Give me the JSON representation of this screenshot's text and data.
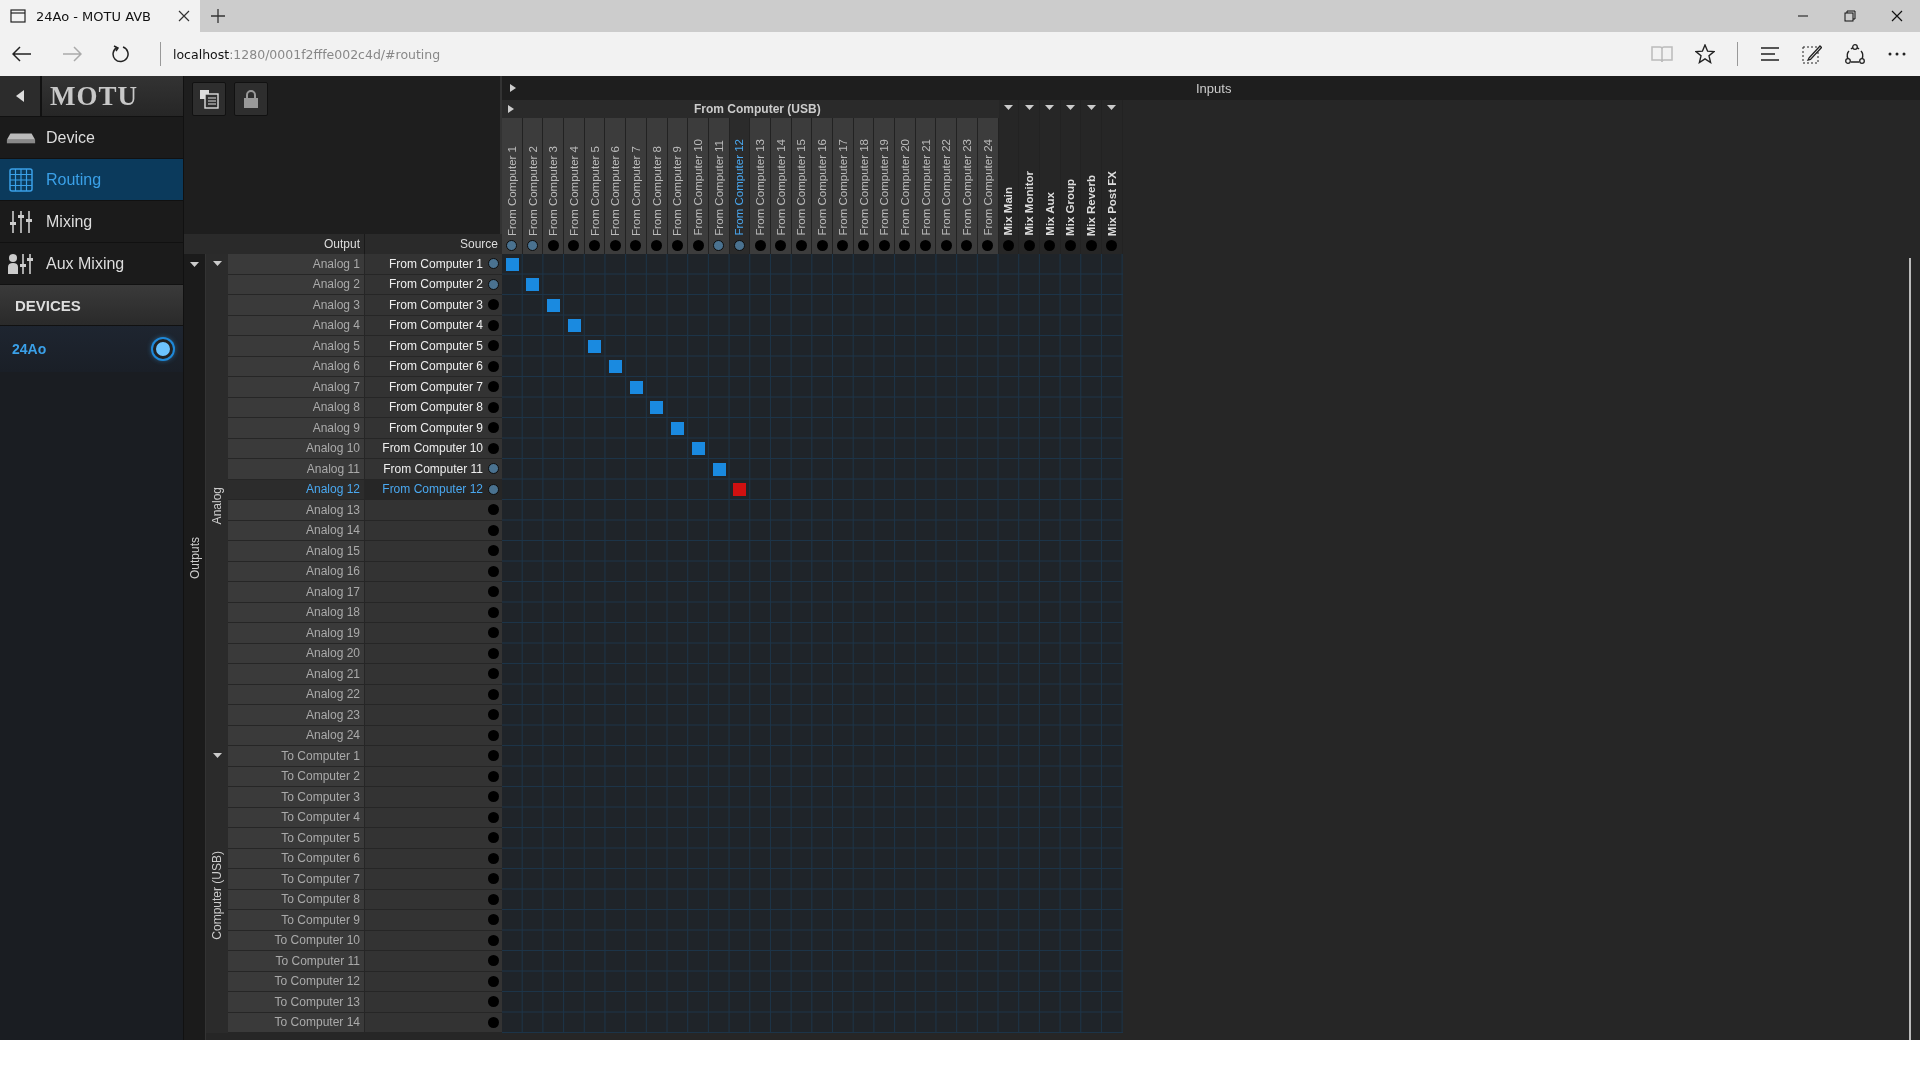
{
  "browser": {
    "tab_title": "24Ao - MOTU AVB",
    "url_host": "localhost",
    "url_path": ":1280/0001f2fffe002c4d/#routing"
  },
  "sidebar": {
    "brand": "MOTU",
    "nav": [
      {
        "label": "Device",
        "kind": "device",
        "selected": false
      },
      {
        "label": "Routing",
        "kind": "routing",
        "selected": true
      },
      {
        "label": "Mixing",
        "kind": "mixing",
        "selected": false
      },
      {
        "label": "Aux Mixing",
        "kind": "aux",
        "selected": false
      }
    ],
    "devices_heading": "DEVICES",
    "devices": [
      {
        "name": "24Ao",
        "selected": true
      }
    ]
  },
  "matrix": {
    "inputs_title": "Inputs",
    "output_header": "Output",
    "source_header": "Source",
    "outputs_title": "Outputs",
    "input_groups": [
      {
        "title": "From Computer (USB)",
        "columns": [
          {
            "label": "From Computer 1",
            "connected": true,
            "selected": false
          },
          {
            "label": "From Computer 2",
            "connected": true,
            "selected": false
          },
          {
            "label": "From Computer 3",
            "connected": false,
            "selected": false
          },
          {
            "label": "From Computer 4",
            "connected": false,
            "selected": false
          },
          {
            "label": "From Computer 5",
            "connected": false,
            "selected": false
          },
          {
            "label": "From Computer 6",
            "connected": false,
            "selected": false
          },
          {
            "label": "From Computer 7",
            "connected": false,
            "selected": false
          },
          {
            "label": "From Computer 8",
            "connected": false,
            "selected": false
          },
          {
            "label": "From Computer 9",
            "connected": false,
            "selected": false
          },
          {
            "label": "From Computer 10",
            "connected": false,
            "selected": false
          },
          {
            "label": "From Computer 11",
            "connected": true,
            "selected": false
          },
          {
            "label": "From Computer 12",
            "connected": true,
            "selected": true
          },
          {
            "label": "From Computer 13",
            "connected": false,
            "selected": false
          },
          {
            "label": "From Computer 14",
            "connected": false,
            "selected": false
          },
          {
            "label": "From Computer 15",
            "connected": false,
            "selected": false
          },
          {
            "label": "From Computer 16",
            "connected": false,
            "selected": false
          },
          {
            "label": "From Computer 17",
            "connected": false,
            "selected": false
          },
          {
            "label": "From Computer 18",
            "connected": false,
            "selected": false
          },
          {
            "label": "From Computer 19",
            "connected": false,
            "selected": false
          },
          {
            "label": "From Computer 20",
            "connected": false,
            "selected": false
          },
          {
            "label": "From Computer 21",
            "connected": false,
            "selected": false
          },
          {
            "label": "From Computer 22",
            "connected": false,
            "selected": false
          },
          {
            "label": "From Computer 23",
            "connected": false,
            "selected": false
          },
          {
            "label": "From Computer 24",
            "connected": false,
            "selected": false
          }
        ]
      }
    ],
    "mix_columns": [
      {
        "label": "Mix Main",
        "connected": false
      },
      {
        "label": "Mix Monitor",
        "connected": false
      },
      {
        "label": "Mix Aux",
        "connected": false
      },
      {
        "label": "Mix Group",
        "connected": false
      },
      {
        "label": "Mix Reverb",
        "connected": false
      },
      {
        "label": "Mix Post FX",
        "connected": false
      }
    ],
    "output_groups": [
      {
        "title": "Analog",
        "rows": [
          {
            "output": "Analog 1",
            "source": "From Computer 1",
            "connected": true,
            "selected": false,
            "patched": true
          },
          {
            "output": "Analog 2",
            "source": "From Computer 2",
            "connected": true,
            "selected": false,
            "patched": true
          },
          {
            "output": "Analog 3",
            "source": "From Computer 3",
            "connected": false,
            "selected": false,
            "patched": true
          },
          {
            "output": "Analog 4",
            "source": "From Computer 4",
            "connected": false,
            "selected": false,
            "patched": true
          },
          {
            "output": "Analog 5",
            "source": "From Computer 5",
            "connected": false,
            "selected": false,
            "patched": true
          },
          {
            "output": "Analog 6",
            "source": "From Computer 6",
            "connected": false,
            "selected": false,
            "patched": true
          },
          {
            "output": "Analog 7",
            "source": "From Computer 7",
            "connected": false,
            "selected": false,
            "patched": true
          },
          {
            "output": "Analog 8",
            "source": "From Computer 8",
            "connected": false,
            "selected": false,
            "patched": true
          },
          {
            "output": "Analog 9",
            "source": "From Computer 9",
            "connected": false,
            "selected": false,
            "patched": true
          },
          {
            "output": "Analog 10",
            "source": "From Computer 10",
            "connected": false,
            "selected": false,
            "patched": true
          },
          {
            "output": "Analog 11",
            "source": "From Computer 11",
            "connected": true,
            "selected": false,
            "patched": true
          },
          {
            "output": "Analog 12",
            "source": "From Computer 12",
            "connected": true,
            "selected": true,
            "patched": true
          },
          {
            "output": "Analog 13",
            "connected": false,
            "selected": false
          },
          {
            "output": "Analog 14",
            "connected": false,
            "selected": false
          },
          {
            "output": "Analog 15",
            "connected": false,
            "selected": false
          },
          {
            "output": "Analog 16",
            "connected": false,
            "selected": false
          },
          {
            "output": "Analog 17",
            "connected": false,
            "selected": false
          },
          {
            "output": "Analog 18",
            "connected": false,
            "selected": false
          },
          {
            "output": "Analog 19",
            "connected": false,
            "selected": false
          },
          {
            "output": "Analog 20",
            "connected": false,
            "selected": false
          },
          {
            "output": "Analog 21",
            "connected": false,
            "selected": false
          },
          {
            "output": "Analog 22",
            "connected": false,
            "selected": false
          },
          {
            "output": "Analog 23",
            "connected": false,
            "selected": false
          },
          {
            "output": "Analog 24",
            "connected": false,
            "selected": false
          }
        ]
      },
      {
        "title": "Computer (USB)",
        "rows": [
          {
            "output": "To Computer 1",
            "connected": false,
            "selected": false
          },
          {
            "output": "To Computer 2",
            "connected": false,
            "selected": false
          },
          {
            "output": "To Computer 3",
            "connected": false,
            "selected": false
          },
          {
            "output": "To Computer 4",
            "connected": false,
            "selected": false
          },
          {
            "output": "To Computer 5",
            "connected": false,
            "selected": false
          },
          {
            "output": "To Computer 6",
            "connected": false,
            "selected": false
          },
          {
            "output": "To Computer 7",
            "connected": false,
            "selected": false
          },
          {
            "output": "To Computer 8",
            "connected": false,
            "selected": false
          },
          {
            "output": "To Computer 9",
            "connected": false,
            "selected": false
          },
          {
            "output": "To Computer 10",
            "connected": false,
            "selected": false
          },
          {
            "output": "To Computer 11",
            "connected": false,
            "selected": false
          },
          {
            "output": "To Computer 12",
            "connected": false,
            "selected": false
          },
          {
            "output": "To Computer 13",
            "connected": false,
            "selected": false
          },
          {
            "output": "To Computer 14",
            "connected": false,
            "selected": false
          }
        ]
      }
    ]
  }
}
